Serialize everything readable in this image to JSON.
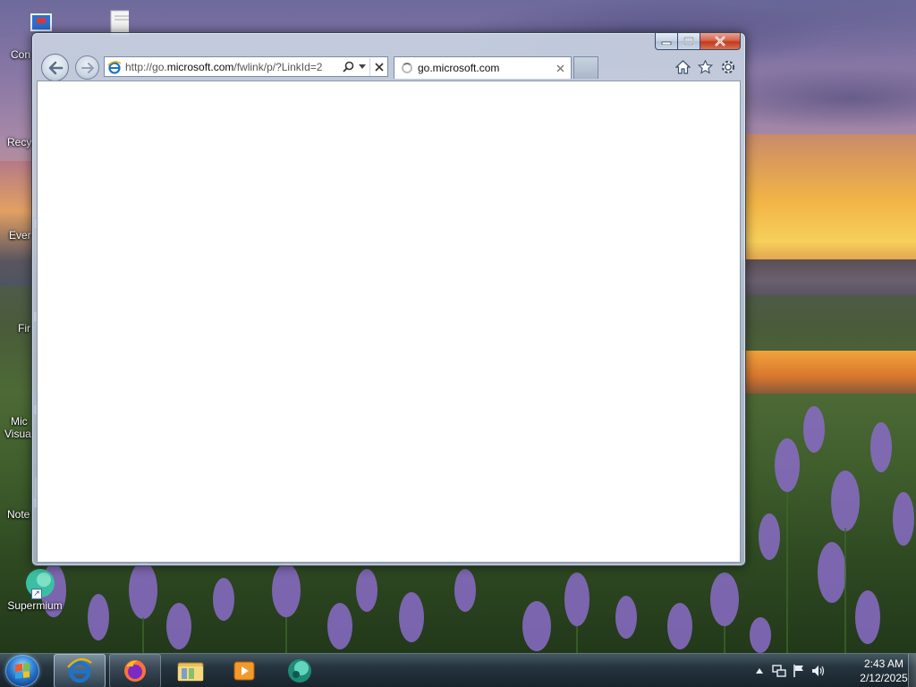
{
  "desktop": {
    "icons": [
      {
        "label": "Con"
      },
      {
        "label": ""
      },
      {
        "label": "Recy"
      },
      {
        "label": "Ever"
      },
      {
        "label": "Fir"
      },
      {
        "label": "Mic"
      },
      {
        "label": "Visua"
      },
      {
        "label": "Note"
      },
      {
        "label": "Supermium"
      }
    ]
  },
  "browser": {
    "address": {
      "prefix": "http://go.",
      "domain": "microsoft.com",
      "path": "/fwlink/p/?LinkId=2"
    },
    "tab": {
      "title": "go.microsoft.com",
      "loading": true
    },
    "colors": {
      "close_button": "#c23a1f",
      "chrome": "#b1c1d8",
      "accent": "#1e72c8"
    }
  },
  "taskbar": {
    "pinned": [
      {
        "name": "internet-explorer",
        "state": "active"
      },
      {
        "name": "firefox",
        "state": "open"
      },
      {
        "name": "file-explorer",
        "state": "pinned"
      },
      {
        "name": "media-player",
        "state": "pinned"
      },
      {
        "name": "supermium",
        "state": "pinned"
      }
    ],
    "clock": {
      "time": "2:43 AM",
      "date": "2/12/2025"
    }
  }
}
